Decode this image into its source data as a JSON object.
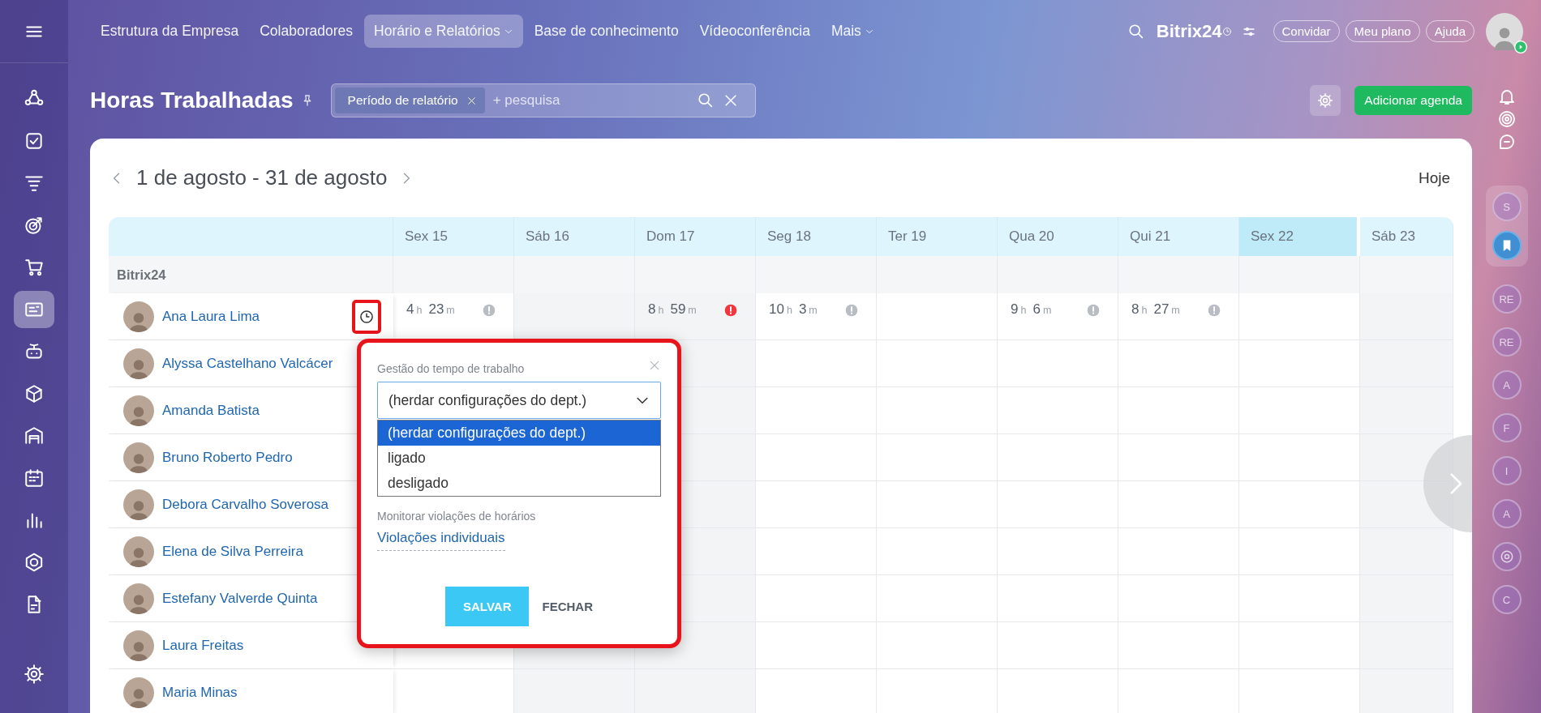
{
  "left_sidebar": {
    "items": [
      {
        "selected": false
      },
      {
        "selected": false
      },
      {
        "selected": false
      },
      {
        "selected": false
      },
      {
        "selected": false
      },
      {
        "selected": true
      },
      {
        "selected": false
      },
      {
        "selected": false
      },
      {
        "selected": false
      },
      {
        "selected": false
      },
      {
        "selected": false
      },
      {
        "selected": false
      },
      {
        "selected": false
      }
    ]
  },
  "top_nav": {
    "items": [
      {
        "label": "Estrutura da Empresa",
        "selected": false,
        "has_menu": false
      },
      {
        "label": "Colaboradores",
        "selected": false,
        "has_menu": false
      },
      {
        "label": "Horário e Relatórios",
        "selected": true,
        "has_menu": true
      },
      {
        "label": "Base de conhecimento",
        "selected": false,
        "has_menu": false
      },
      {
        "label": "Vídeoconferência",
        "selected": false,
        "has_menu": false
      },
      {
        "label": "Mais",
        "selected": false,
        "has_menu": true
      }
    ]
  },
  "logo": "Bitrix24",
  "header_buttons": [
    "Convidar",
    "Meu plano",
    "Ajuda"
  ],
  "page": {
    "title": "Horas Trabalhadas",
    "filter": {
      "chip": "Período de relatório",
      "placeholder": "+ pesquisa"
    },
    "add_button": "Adicionar agenda"
  },
  "calendar": {
    "period": "1 de agosto - 31 de agosto",
    "today_button": "Hoje",
    "days": [
      {
        "label": "Sex 15",
        "weekend": false,
        "today": false
      },
      {
        "label": "Sáb 16",
        "weekend": true,
        "today": false
      },
      {
        "label": "Dom 17",
        "weekend": true,
        "today": false
      },
      {
        "label": "Seg 18",
        "weekend": false,
        "today": false
      },
      {
        "label": "Ter 19",
        "weekend": false,
        "today": false
      },
      {
        "label": "Qua 20",
        "weekend": false,
        "today": false
      },
      {
        "label": "Qui 21",
        "weekend": false,
        "today": false
      },
      {
        "label": "Sex 22",
        "weekend": false,
        "today": true
      },
      {
        "label": "Sáb 23",
        "weekend": true,
        "today": false
      }
    ],
    "group": "Bitrix24",
    "people": [
      {
        "name": "Ana Laura Lima",
        "settings_open": true,
        "cells": [
          {
            "hours": "4",
            "hours_unit": "h",
            "minutes": "23",
            "minutes_unit": "m",
            "violation": false
          },
          null,
          {
            "hours": "8",
            "hours_unit": "h",
            "minutes": "59",
            "minutes_unit": "m",
            "violation": true
          },
          {
            "hours": "10",
            "hours_unit": "h",
            "minutes": "3",
            "minutes_unit": "m",
            "violation": false
          },
          null,
          {
            "hours": "9",
            "hours_unit": "h",
            "minutes": "6",
            "minutes_unit": "m",
            "violation": false
          },
          {
            "hours": "8",
            "hours_unit": "h",
            "minutes": "27",
            "minutes_unit": "m",
            "violation": false
          },
          null,
          null
        ]
      },
      {
        "name": "Alyssa Castelhano Valcácer",
        "settings_open": false
      },
      {
        "name": "Amanda Batista",
        "settings_open": false
      },
      {
        "name": "Bruno Roberto Pedro",
        "settings_open": false
      },
      {
        "name": "Debora Carvalho Soverosa",
        "settings_open": false
      },
      {
        "name": "Elena de Silva Perreira",
        "settings_open": false
      },
      {
        "name": "Estefany Valverde Quinta",
        "settings_open": false
      },
      {
        "name": "Laura Freitas",
        "settings_open": false
      },
      {
        "name": "Maria Minas",
        "settings_open": false
      }
    ]
  },
  "popup": {
    "title": "Gestão do tempo de trabalho",
    "select": {
      "value": "(herdar configurações do dept.)",
      "expanded": true,
      "options": [
        {
          "label": "(herdar configurações do dept.)",
          "selected": true
        },
        {
          "label": "ligado",
          "selected": false
        },
        {
          "label": "desligado",
          "selected": false
        }
      ]
    },
    "violations_label": "Monitorar violações de horários",
    "violations_link": "Violações individuais",
    "save_button": "SALVAR",
    "close_button": "FECHAR"
  },
  "right_panel": {
    "pinned": [
      {
        "kind": "letter",
        "text": "S"
      },
      {
        "kind": "bookmark"
      }
    ],
    "chats": [
      {
        "kind": "letter",
        "text": "RE"
      },
      {
        "kind": "letter",
        "text": "RE"
      },
      {
        "kind": "letter",
        "text": "A"
      },
      {
        "kind": "letter",
        "text": "F"
      },
      {
        "kind": "letter",
        "text": "I"
      },
      {
        "kind": "letter",
        "text": "A"
      },
      {
        "kind": "icon"
      },
      {
        "kind": "letter",
        "text": "C"
      }
    ]
  }
}
